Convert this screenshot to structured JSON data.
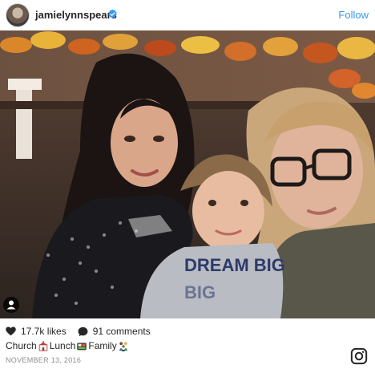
{
  "header": {
    "username": "jamielynnspears",
    "follow_label": "Follow",
    "verified": true
  },
  "photo": {
    "description_icon": "photo",
    "shirt_text": "DREAM BIG"
  },
  "post": {
    "likes": "17.7k likes",
    "comments": "91 comments",
    "caption_words": [
      "Church",
      "Lunch",
      "Family"
    ],
    "date": "NOVEMBER 13, 2016"
  },
  "icons": {
    "heart": "heart-icon",
    "comment": "comment-bubble-icon",
    "instagram": "instagram-icon",
    "user_tag": "user-tag-icon",
    "verified": "verified-badge-icon"
  },
  "colors": {
    "follow": "#3897f0",
    "verified": "#3897f0",
    "date": "#8e8e8e"
  }
}
